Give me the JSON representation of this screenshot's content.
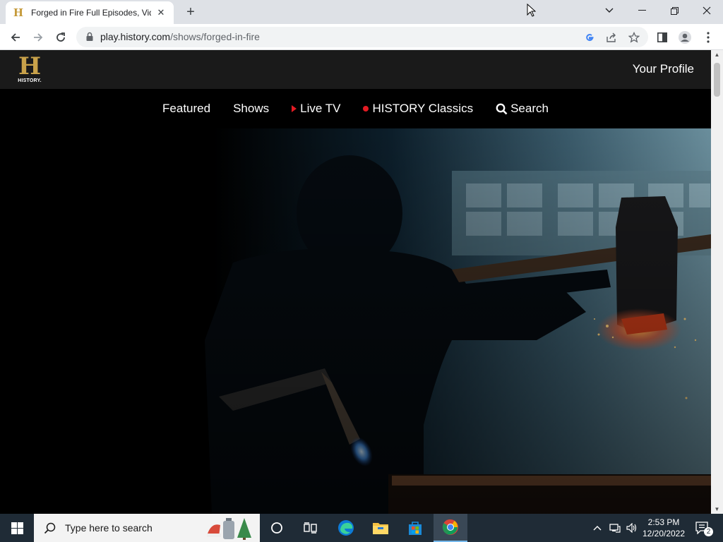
{
  "browser": {
    "tab": {
      "title": "Forged in Fire Full Episodes, Vide",
      "favicon_letter": "H"
    },
    "url_host": "play.history.com",
    "url_path": "/shows/forged-in-fire"
  },
  "site": {
    "logo": {
      "letter": "H",
      "wordmark": "HISTORY."
    },
    "profile_label": "Your Profile",
    "nav": {
      "featured": "Featured",
      "shows": "Shows",
      "live_tv": "Live TV",
      "classics": "HISTORY Classics",
      "search": "Search"
    }
  },
  "taskbar": {
    "search_placeholder": "Type here to search",
    "time": "2:53 PM",
    "date": "12/20/2022",
    "notification_count": "2"
  },
  "colors": {
    "accent_gold": "#c9a24a",
    "live_red": "#e31b23",
    "taskbar": "#1f2b36"
  }
}
